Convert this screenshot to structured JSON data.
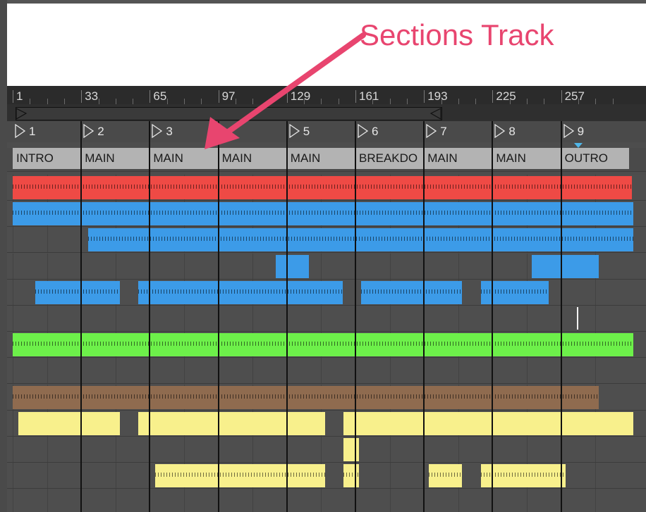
{
  "annotation": {
    "text": "Sections Track",
    "color": "#e8456f"
  },
  "ruler": {
    "ticks": [
      "1",
      "33",
      "65",
      "97",
      "129",
      "161",
      "193",
      "225",
      "257"
    ]
  },
  "locators": [
    "1",
    "2",
    "3",
    "",
    "5",
    "6",
    "7",
    "8",
    "9"
  ],
  "sections_track": {
    "sections": [
      "INTRO",
      "MAIN",
      "MAIN",
      "MAIN",
      "MAIN",
      "BREAKDO",
      "MAIN",
      "MAIN",
      "OUTRO"
    ]
  },
  "colors": {
    "red": "#ef4a45",
    "blue": "#3c9be8",
    "green": "#6df04a",
    "brown": "#8f6b4f",
    "yellow": "#f8f08c",
    "section": "#b3b3b3",
    "playhead_marker": "#4fb6e8"
  },
  "tracks": [
    {
      "name": "red-track",
      "color": "red",
      "clips": [
        [
          0,
          878,
          "hatch"
        ]
      ]
    },
    {
      "name": "blue-track-1",
      "color": "blue",
      "clips": [
        [
          0,
          880,
          "hatch"
        ]
      ]
    },
    {
      "name": "blue-track-2",
      "color": "blue",
      "clips": [
        [
          107,
          880,
          "hatch"
        ]
      ]
    },
    {
      "name": "blue-track-3",
      "color": "blue",
      "clips": [
        [
          373,
          420,
          "plain"
        ],
        [
          736,
          831,
          "plain"
        ]
      ]
    },
    {
      "name": "blue-track-4",
      "color": "blue",
      "clips": [
        [
          32,
          152,
          "hatch"
        ],
        [
          178,
          468,
          "hatch"
        ],
        [
          494,
          637,
          "hatch"
        ],
        [
          664,
          760,
          "hatch"
        ]
      ]
    },
    {
      "name": "empty-track-1",
      "color": "",
      "clips": []
    },
    {
      "name": "green-track",
      "color": "green",
      "clips": [
        [
          0,
          880,
          "hatch"
        ]
      ]
    },
    {
      "name": "empty-track-2",
      "color": "",
      "clips": []
    },
    {
      "name": "brown-track",
      "color": "brown",
      "clips": [
        [
          0,
          831,
          "hatch"
        ]
      ]
    },
    {
      "name": "yellow-track-1",
      "color": "yellow",
      "clips": [
        [
          8,
          152,
          "plain"
        ],
        [
          178,
          443,
          "plain"
        ],
        [
          469,
          880,
          "plain"
        ]
      ]
    },
    {
      "name": "yellow-track-2",
      "color": "yellow",
      "clips": [
        [
          469,
          491,
          "plain"
        ]
      ]
    },
    {
      "name": "yellow-track-3",
      "color": "yellow",
      "clips": [
        [
          202,
          443,
          "hatch"
        ],
        [
          469,
          491,
          "hatch"
        ],
        [
          590,
          637,
          "hatch"
        ],
        [
          664,
          784,
          "hatch"
        ]
      ]
    },
    {
      "name": "empty-track-3",
      "color": "",
      "clips": []
    }
  ]
}
